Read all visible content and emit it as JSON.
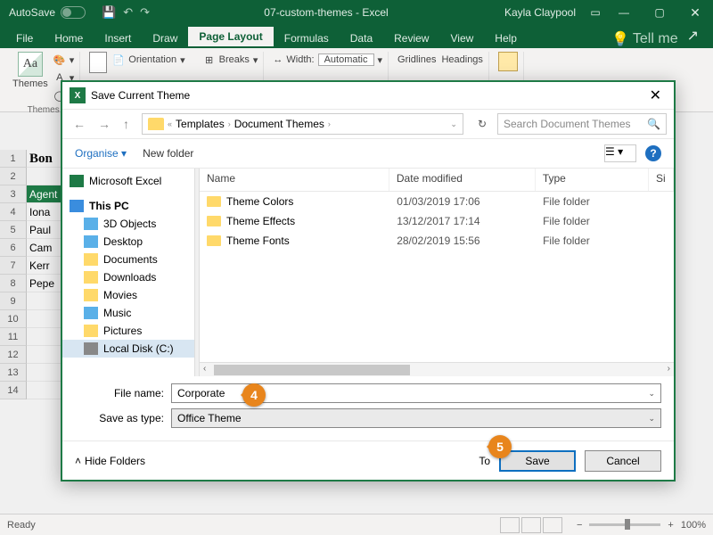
{
  "titlebar": {
    "autosave": "AutoSave",
    "doc_title": "07-custom-themes - Excel",
    "user": "Kayla Claypool"
  },
  "tabs": [
    "File",
    "Home",
    "Insert",
    "Draw",
    "Page Layout",
    "Formulas",
    "Data",
    "Review",
    "View",
    "Help"
  ],
  "active_tab": "Page Layout",
  "tell_me": "Tell me",
  "ribbon": {
    "themes": "Themes",
    "themes_group": "Themes",
    "orientation": "Orientation",
    "breaks": "Breaks",
    "width": "Width:",
    "width_val": "Automatic",
    "gridlines": "Gridlines",
    "headings": "Headings"
  },
  "cells": {
    "a1": "Bon",
    "a3": "Agent",
    "a4": "Iona",
    "a5": "Paul",
    "a6": "Cam",
    "a7": "Kerr",
    "a8": "Pepe"
  },
  "dialog": {
    "title": "Save Current Theme",
    "crumb1": "Templates",
    "crumb2": "Document Themes",
    "search_ph": "Search Document Themes",
    "organise": "Organise",
    "new_folder": "New folder",
    "tree": {
      "excel": "Microsoft Excel",
      "thispc": "This PC",
      "n3d": "3D Objects",
      "desktop": "Desktop",
      "documents": "Documents",
      "downloads": "Downloads",
      "movies": "Movies",
      "music": "Music",
      "pictures": "Pictures",
      "localdisk": "Local Disk (C:)"
    },
    "cols": {
      "name": "Name",
      "date": "Date modified",
      "type": "Type",
      "size": "Si"
    },
    "files": [
      {
        "name": "Theme Colors",
        "date": "01/03/2019 17:06",
        "type": "File folder"
      },
      {
        "name": "Theme Effects",
        "date": "13/12/2017 17:14",
        "type": "File folder"
      },
      {
        "name": "Theme Fonts",
        "date": "28/02/2019 15:56",
        "type": "File folder"
      }
    ],
    "filename_label": "File name:",
    "filename_value": "Corporate",
    "saveas_label": "Save as type:",
    "saveas_value": "Office Theme",
    "hide_folders": "Hide Folders",
    "tools": "To",
    "save": "Save",
    "cancel": "Cancel"
  },
  "callouts": {
    "c4": "4",
    "c5": "5"
  },
  "status": {
    "ready": "Ready",
    "zoom": "100%"
  }
}
